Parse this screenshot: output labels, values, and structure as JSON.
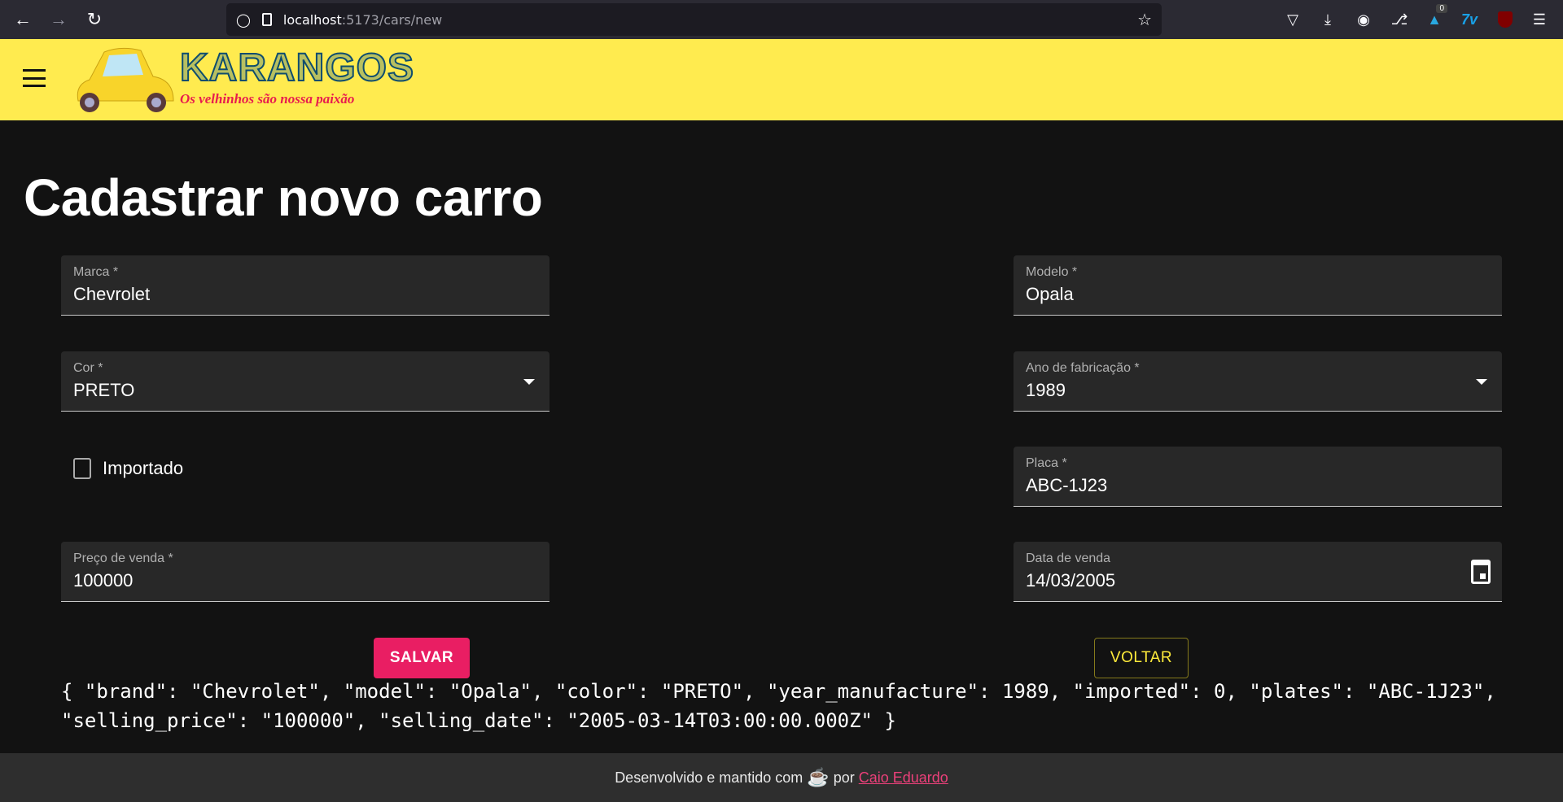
{
  "browser": {
    "url_host": "localhost",
    "url_rest": ":5173/cars/new",
    "extension_badge": "0"
  },
  "header": {
    "logo_title": "KARANGOS",
    "logo_tagline": "Os velhinhos são nossa paixão"
  },
  "page": {
    "title": "Cadastrar novo carro"
  },
  "form": {
    "brand": {
      "label": "Marca *",
      "value": "Chevrolet"
    },
    "model": {
      "label": "Modelo *",
      "value": "Opala"
    },
    "color": {
      "label": "Cor *",
      "value": "PRETO"
    },
    "year": {
      "label": "Ano de fabricação *",
      "value": "1989"
    },
    "imported": {
      "label": "Importado",
      "checked": false
    },
    "plates": {
      "label": "Placa *",
      "value": "ABC-1J23"
    },
    "price": {
      "label": "Preço de venda *",
      "value": "100000"
    },
    "date": {
      "label": "Data de venda",
      "value": "14/03/2005"
    },
    "save_label": "SALVAR",
    "back_label": "VOLTAR"
  },
  "debug_json": "{ \"brand\": \"Chevrolet\", \"model\": \"Opala\", \"color\": \"PRETO\", \"year_manufacture\": 1989, \"imported\": 0, \"plates\": \"ABC-1J23\", \"selling_price\": \"100000\", \"selling_date\": \"2005-03-14T03:00:00.000Z\" }",
  "footer": {
    "text_before": "Desenvolvido e mantido com",
    "text_after": "por",
    "author": "Caio Eduardo"
  },
  "colors": {
    "header": "#ffeb4f",
    "primary": "#e91e63",
    "secondary": "#ffeb3b",
    "background": "#121212"
  }
}
